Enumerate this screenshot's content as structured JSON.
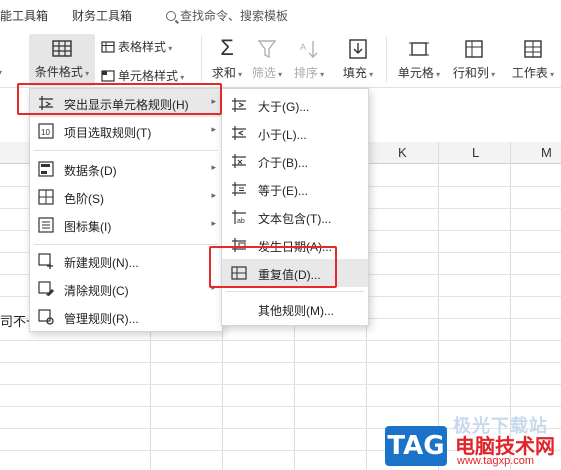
{
  "tabs": [
    "能工具箱",
    "财务工具箱"
  ],
  "search": {
    "label": "查找命令、搜索模板"
  },
  "ribbon": {
    "cond_format": "条件格式",
    "table_style": "表格样式",
    "cell_style": "单元格样式",
    "sum": "求和",
    "filter": "筛选",
    "sort": "排序",
    "fill": "填充",
    "cell": "单元格",
    "row_col": "行和列",
    "worksheet": "工作表",
    "left_frag": "·"
  },
  "columns": [
    "K",
    "L",
    "M"
  ],
  "cell_fragment": "司不一",
  "main_menu": [
    {
      "label": "突出显示单元格规则(H)",
      "icon": "highlight-rules-icon",
      "submenu": true,
      "highlighted": true
    },
    {
      "label": "项目选取规则(T)",
      "icon": "top10-icon",
      "submenu": true
    },
    {
      "label": "数据条(D)",
      "icon": "databar-icon",
      "submenu": true
    },
    {
      "label": "色阶(S)",
      "icon": "color-scale-icon",
      "submenu": true
    },
    {
      "label": "图标集(I)",
      "icon": "icon-set-icon",
      "submenu": true
    },
    {
      "label": "新建规则(N)...",
      "icon": "new-rule-icon",
      "submenu": false
    },
    {
      "label": "清除规则(C)",
      "icon": "clear-rules-icon",
      "submenu": true
    },
    {
      "label": "管理规则(R)...",
      "icon": "manage-rules-icon",
      "submenu": false
    }
  ],
  "sub_menu": [
    {
      "label": "大于(G)...",
      "icon": "greater-than-icon"
    },
    {
      "label": "小于(L)...",
      "icon": "less-than-icon"
    },
    {
      "label": "介于(B)...",
      "icon": "between-icon"
    },
    {
      "label": "等于(E)...",
      "icon": "equal-icon"
    },
    {
      "label": "文本包含(T)...",
      "icon": "text-contains-icon"
    },
    {
      "label": "发生日期(A)...",
      "icon": "date-occurring-icon"
    },
    {
      "label": "重复值(D)...",
      "icon": "duplicate-values-icon",
      "highlighted": true
    },
    {
      "label": "其他规则(M)...",
      "icon": ""
    }
  ],
  "watermark": {
    "logo": "TAG",
    "site_name": "电脑技术网",
    "url": "www.tagxp.com",
    "ghost": "极光下载站"
  }
}
